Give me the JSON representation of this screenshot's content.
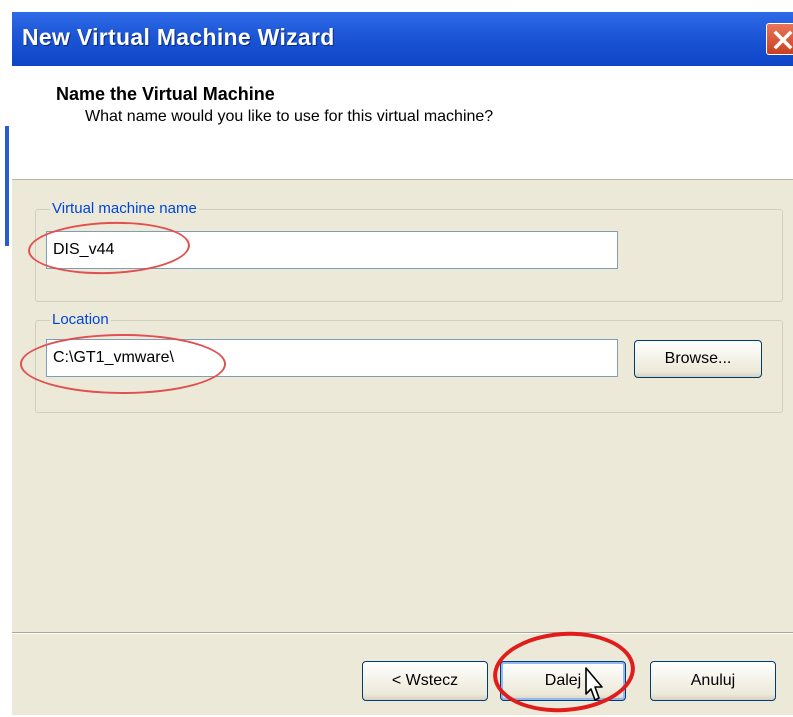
{
  "window": {
    "title": "New Virtual Machine Wizard",
    "close_icon": "close-icon"
  },
  "header": {
    "title": "Name the Virtual Machine",
    "subtitle": "What name would you like to use for this virtual machine?"
  },
  "form": {
    "name_label": "Virtual machine name",
    "name_value": "DIS_v44",
    "location_label": "Location",
    "location_value": "C:\\GT1_vmware\\",
    "browse_label": "Browse..."
  },
  "footer": {
    "back_label": "< Wstecz",
    "next_label": "Dalej",
    "cancel_label": "Anuluj"
  },
  "colors": {
    "titlebar": "#0e45c8",
    "annotation": "#e21b1b",
    "dialog_bg": "#ece9d8"
  }
}
